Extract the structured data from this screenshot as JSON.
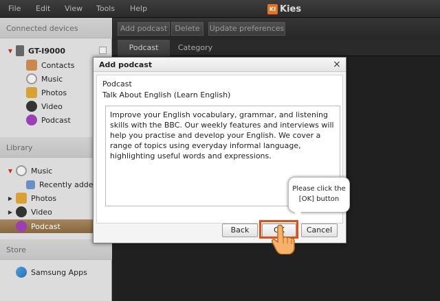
{
  "menu": [
    "File",
    "Edit",
    "View",
    "Tools",
    "Help"
  ],
  "app_title": "Kies",
  "logo_mark": "KI",
  "sidebar": {
    "connected_header": "Connected devices",
    "device_name": "GT-I9000",
    "device_items": [
      "Contacts",
      "Music",
      "Photos",
      "Video",
      "Podcast"
    ],
    "library_header": "Library",
    "library_items": [
      "Music",
      "Recently added",
      "Photos",
      "Video",
      "Podcast"
    ],
    "store_header": "Store",
    "store_items": [
      "Samsung Apps"
    ]
  },
  "toolbar": {
    "add_podcast": "Add podcast",
    "delete": "Delete",
    "update_prefs": "Update preferences"
  },
  "tabs": [
    "Podcast",
    "Category"
  ],
  "dialog": {
    "title": "Add podcast",
    "close": "×",
    "label": "Podcast",
    "podcast_name": "Talk About English (Learn English)",
    "description": "Improve your English vocabulary, grammar, and listening skills with the BBC. Our weekly features and interviews will help you practise and develop your English. We cover a range of topics using everyday informal language, highlighting useful words and expressions.",
    "back": "Back",
    "ok": "OK",
    "cancel": "Cancel"
  },
  "tooltip": {
    "line1": "Please click the",
    "line2": "[OK] button"
  },
  "colors": {
    "accent": "#e84a10",
    "selected": "#8a6a42",
    "logo": "#e8731c"
  }
}
